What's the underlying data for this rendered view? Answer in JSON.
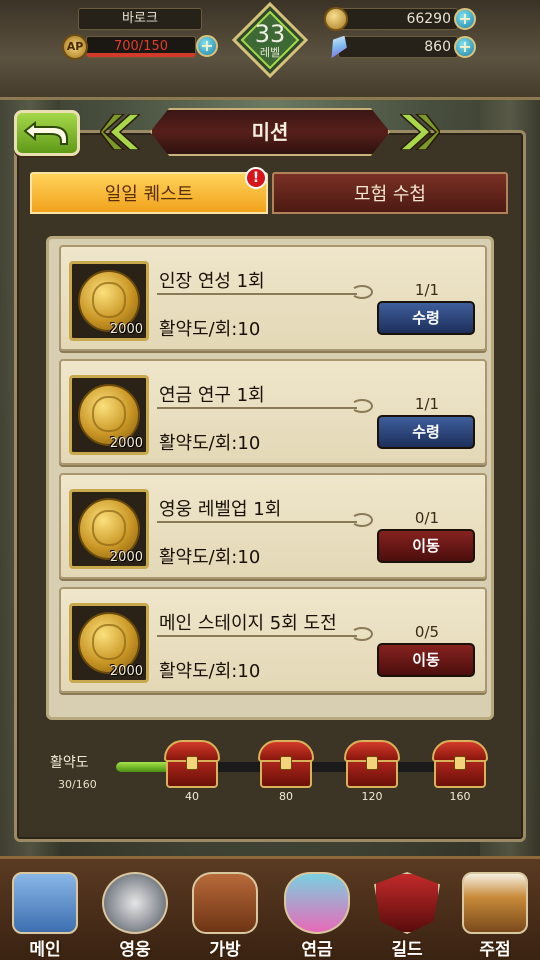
{
  "hud": {
    "player_name": "바로크",
    "ap_icon": "AP",
    "ap_value": "700/150",
    "level": "33",
    "level_label": "레벨",
    "gold": "66290",
    "gems": "860"
  },
  "header": {
    "title": "미션"
  },
  "tabs": [
    {
      "label": "일일 퀘스트",
      "active": true
    },
    {
      "label": "모험 수첩",
      "active": false
    }
  ],
  "alert_badge": "!",
  "quests": [
    {
      "title": "인장 연성 1회",
      "desc": "활약도/회:10",
      "progress": "1/1",
      "reward": "2000",
      "button": "수령",
      "state": "claim"
    },
    {
      "title": "연금 연구 1회",
      "desc": "활약도/회:10",
      "progress": "1/1",
      "reward": "2000",
      "button": "수령",
      "state": "claim"
    },
    {
      "title": "영웅 레벨업 1회",
      "desc": "활약도/회:10",
      "progress": "0/1",
      "reward": "2000",
      "button": "이동",
      "state": "go"
    },
    {
      "title": "메인 스테이지 5회 도전",
      "desc": "활약도/회:10",
      "progress": "0/5",
      "reward": "2000",
      "button": "이동",
      "state": "go"
    }
  ],
  "activity": {
    "label": "활약도",
    "count": "30/160",
    "progress_fraction": 0.1875,
    "milestones": [
      "40",
      "80",
      "120",
      "160"
    ]
  },
  "nav": [
    {
      "label": "메인",
      "icon": "castle-icon"
    },
    {
      "label": "영웅",
      "icon": "knight-helmet-icon"
    },
    {
      "label": "가방",
      "icon": "bag-icon"
    },
    {
      "label": "연금",
      "icon": "potion-icon"
    },
    {
      "label": "길드",
      "icon": "guild-shield-icon"
    },
    {
      "label": "주점",
      "icon": "tavern-icon"
    }
  ],
  "colors": {
    "tab_active": "#f1a21d",
    "tab_inactive": "#4c1a12",
    "button_claim": "#1d2f5a",
    "button_go": "#4b0e0c",
    "activity_fill": "#6ab82a"
  }
}
